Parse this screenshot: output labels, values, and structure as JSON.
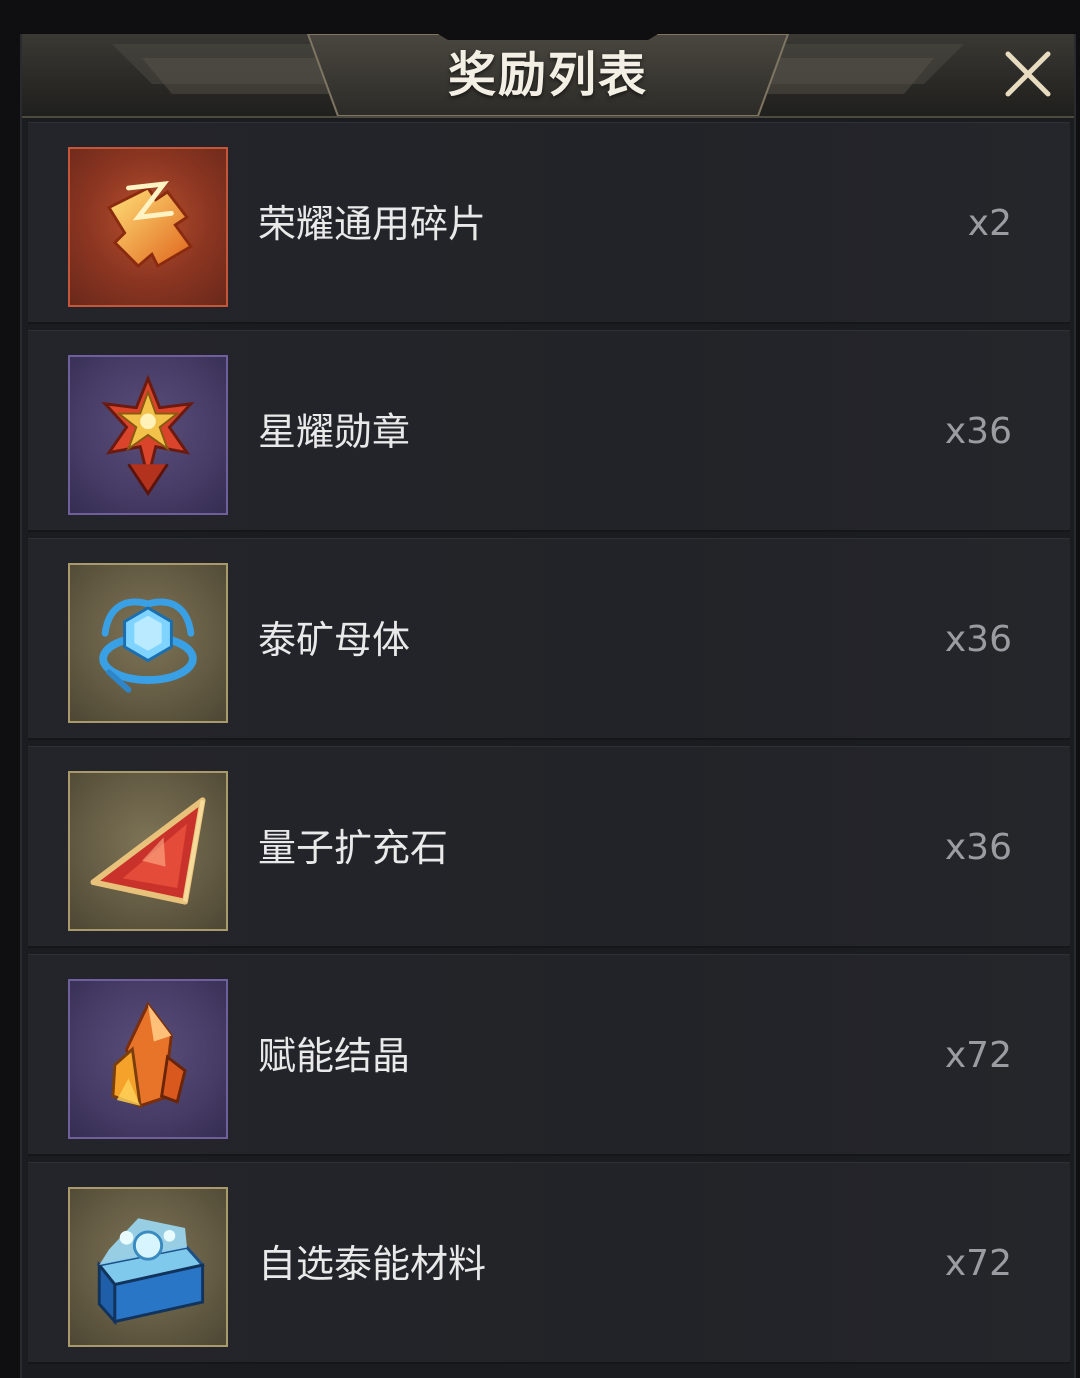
{
  "dialog": {
    "title": "奖励列表",
    "close_icon": "close-icon"
  },
  "rewards": [
    {
      "name": "荣耀通用碎片",
      "quantity": "x2",
      "icon": "puzzle-fragment-icon",
      "rarity_color": "#c4573a"
    },
    {
      "name": "星耀勋章",
      "quantity": "x36",
      "icon": "star-medal-icon",
      "rarity_color": "#6f5f9a"
    },
    {
      "name": "泰矿母体",
      "quantity": "x36",
      "icon": "blue-crystal-icon",
      "rarity_color": "#a89a6a"
    },
    {
      "name": "量子扩充石",
      "quantity": "x36",
      "icon": "triangle-stone-icon",
      "rarity_color": "#a89a6a"
    },
    {
      "name": "赋能结晶",
      "quantity": "x72",
      "icon": "orange-crystal-icon",
      "rarity_color": "#6f5f9a"
    },
    {
      "name": "自选泰能材料",
      "quantity": "x72",
      "icon": "treasure-chest-icon",
      "rarity_color": "#a89a6a"
    }
  ]
}
